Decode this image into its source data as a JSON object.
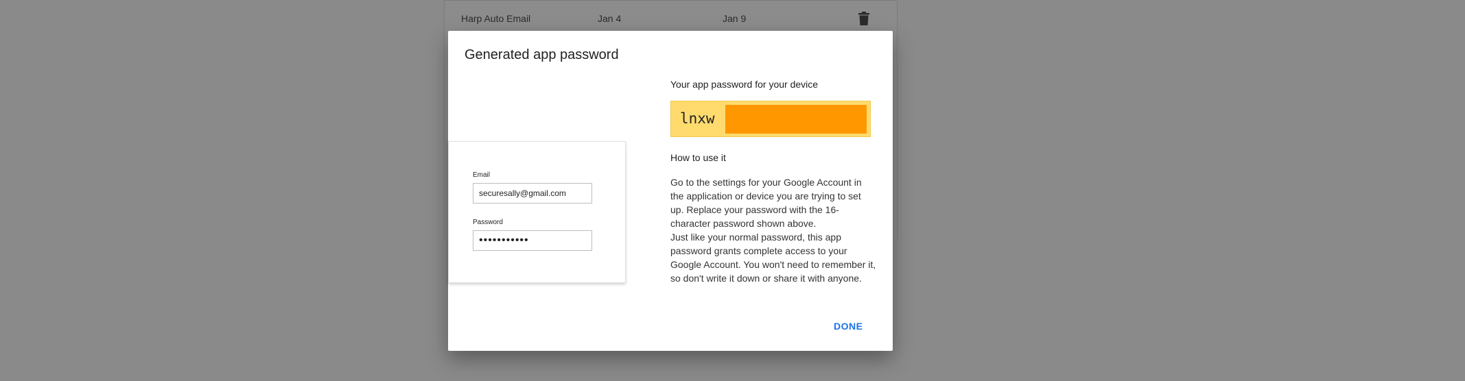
{
  "background_table": {
    "row": {
      "name": "Harp Auto Email",
      "created": "Jan 4",
      "last_used": "Jan 9",
      "delete_icon": "trash-icon"
    }
  },
  "dialog": {
    "title": "Generated app password",
    "illustration": {
      "email_label": "Email",
      "email_value": "securesally@gmail.com",
      "password_label": "Password",
      "password_value": "•••••••••••"
    },
    "password_heading": "Your app password for your device",
    "password_prefix": "lnxw",
    "howto_heading": "How to use it",
    "howto_paragraph_1": "Go to the settings for your Google Account in the application or device you are trying to set up. Replace your password with the 16-character password shown above.",
    "howto_paragraph_2": "Just like your normal password, this app password grants complete access to your Google Account. You won't need to remember it, so don't write it down or share it with anyone.",
    "done_label": "DONE"
  },
  "colors": {
    "accent": "#1a73e8",
    "password_box": "#ffdb6e",
    "redaction": "#ff9800",
    "overlay": "#8a8a8a"
  }
}
